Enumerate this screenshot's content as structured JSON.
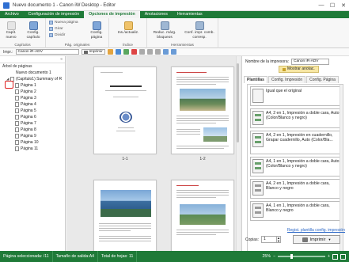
{
  "window": {
    "title": "Nuevo documento 1 - Canon iW Desktop - Editor"
  },
  "ribbon_tabs": [
    "Archivo",
    "Configuración de impresión",
    "Opciones de impresión",
    "Anotaciones",
    "Herramientas"
  ],
  "ribbon": {
    "groups": [
      {
        "label": "Capítulos",
        "buttons": [
          "Capít. nuevo",
          "Config. capítulo"
        ]
      },
      {
        "label": "Pág. originales",
        "small": [
          "Nueva página",
          "Girar",
          "Dividir"
        ],
        "buttons": [
          "Config. página"
        ]
      },
      {
        "label": "Índice",
        "buttons": [
          "Ins./actualiz."
        ]
      },
      {
        "label": "Herramientas",
        "buttons": [
          "Reduc. márg. bloqueos",
          "Conf. impr. comb. corresp."
        ]
      }
    ]
  },
  "toolbar": {
    "printer_label": "Impr.:",
    "printer_value": "Canon iR-ADV",
    "print_label": "Imprimir"
  },
  "tree": {
    "header": "Árbol de páginas",
    "document": "Nuevo documento 1",
    "chapter": "(Capítulo1) Summary of R",
    "pages": [
      "Página 1",
      "Página 2",
      "Página 3",
      "Página 4",
      "Página 5",
      "Página 6",
      "Página 7",
      "Página 8",
      "Página 9",
      "Página 10",
      "Página 11"
    ]
  },
  "pages": {
    "labels": [
      "1-1",
      "1-2"
    ]
  },
  "settings": {
    "printer_label": "Nombre de la impresora:",
    "printer_value": "Canon iR-ADV",
    "annotation_button": "Mostrar anotac.",
    "tabs": [
      "Plantillas",
      "Config. Impresión",
      "Config. Página"
    ],
    "favorites": [
      "Igual que el original",
      "A4, 2 en 1, Impresión a doble cara, Auto (Color/Blanco y negro)",
      "A4, 2 en 1, Impresión en cuadernillo, Grapar cuadernillo, Auto (Color/Bla...",
      "A4, 1 en 1, Impresión a doble cara, Auto (Color/Blanco y negro)",
      "A4, 2 en 1, Impresión a doble cara, Blanco y negro",
      "A4, 1 en 1, Impresión a doble cara, Blanco y negro"
    ],
    "register_link": "Regist. plantilla config. impresión",
    "copies_label": "Copias:",
    "copies_value": "1",
    "print_button": "Imprimir"
  },
  "statusbar": {
    "items": [
      "Página seleccionada: /11",
      "Tamaño de salida:A4",
      "Total de hojas: 11"
    ],
    "zoom": "25%"
  },
  "colors": {
    "accent": "#1f7a38",
    "highlight": "#e02020"
  }
}
